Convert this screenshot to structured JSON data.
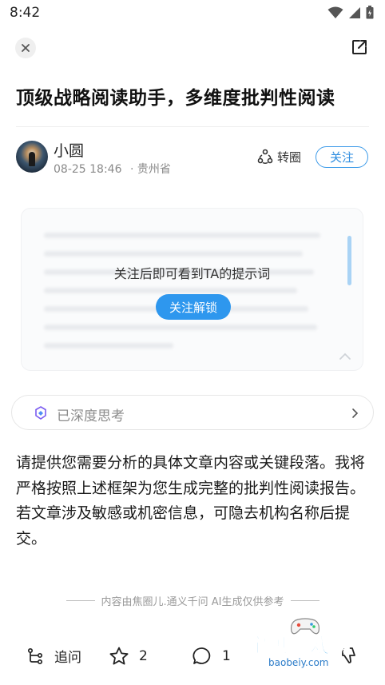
{
  "status_bar": {
    "time": "8:42"
  },
  "post": {
    "title": "顶级战略阅读助手，多维度批判性阅读",
    "author": {
      "name": "小圆",
      "date": "08-25 18:46",
      "location": "· 贵州省"
    },
    "repost_label": "转圈",
    "follow_label": "关注"
  },
  "prompt_card": {
    "lock_text": "关注后即可看到TA的提示词",
    "unlock_label": "关注解锁"
  },
  "thought": {
    "label": "已深度思考"
  },
  "answer": {
    "text": "请提供您需要分析的具体文章内容或关键段落。我将严格按照上述框架为您生成完整的批判性阅读报告。若文章涉及敏感或机密信息，可隐去机构名称后提交。"
  },
  "disclaimer": "内容由焦圈儿.通义千问 AI生成仅供参考",
  "bottom_bar": {
    "followup_label": "追问",
    "star_count": "2",
    "comment_count": "1"
  },
  "watermark": {
    "title": "宝贝游戏网",
    "url": "baobeiy.com"
  },
  "colors": {
    "accent": "#2e97ee",
    "follow_border": "#3d9be9",
    "muted_text": "#8a8a8a"
  },
  "icons": [
    "close-icon",
    "share-icon",
    "repost-icon",
    "deep-think-icon",
    "chevron-right-icon",
    "followup-icon",
    "star-icon",
    "comment-icon",
    "dislike-icon"
  ]
}
